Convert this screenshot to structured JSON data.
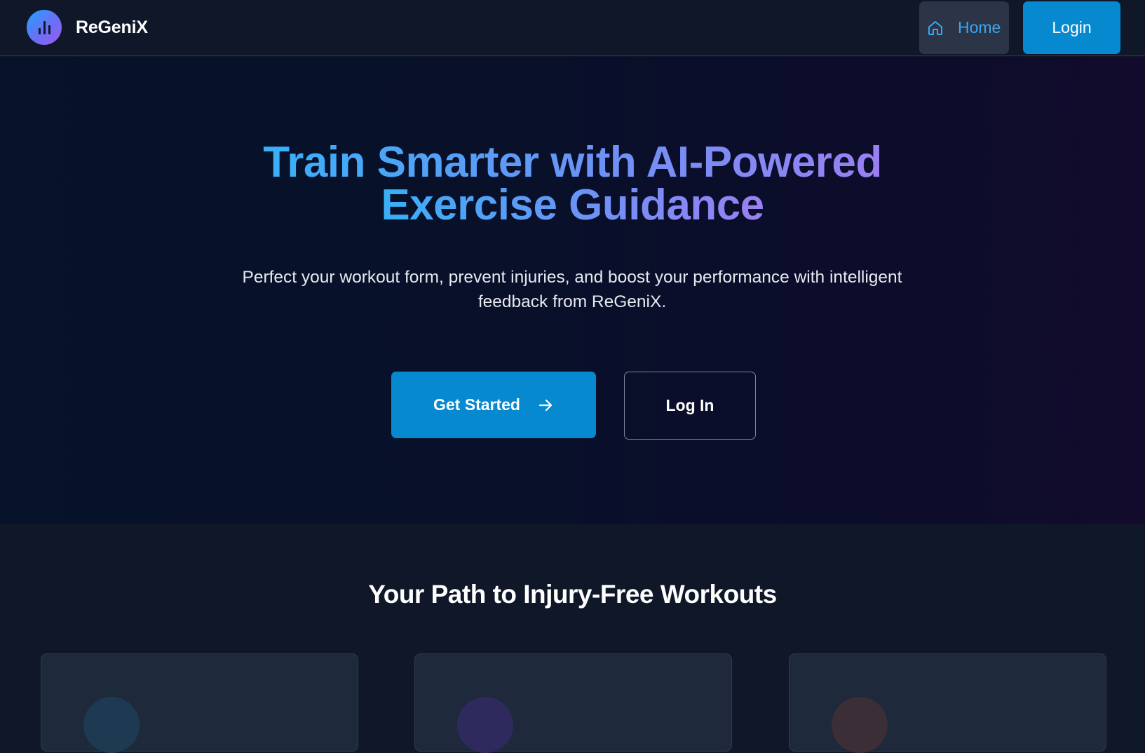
{
  "navbar": {
    "brand_name": "ReGeniX",
    "home_label": "Home",
    "login_label": "Login"
  },
  "hero": {
    "title_line1": "Train Smarter with AI-Powered",
    "title_line2": "Exercise Guidance",
    "subtitle": "Perfect your workout form, prevent injuries, and boost your performance with intelligent feedback from ReGeniX.",
    "get_started_label": "Get Started",
    "log_in_label": "Log In"
  },
  "path_section": {
    "title": "Your Path to Injury-Free Workouts",
    "cards": [
      {
        "icon_color": "#1e3a52"
      },
      {
        "icon_color": "#2f2a5e"
      },
      {
        "icon_color": "#3b2e36"
      }
    ]
  },
  "colors": {
    "accent_blue": "#0789cf",
    "home_text": "#38a8f0",
    "page_bg": "#0f1729",
    "card_bg": "#1e293b"
  }
}
